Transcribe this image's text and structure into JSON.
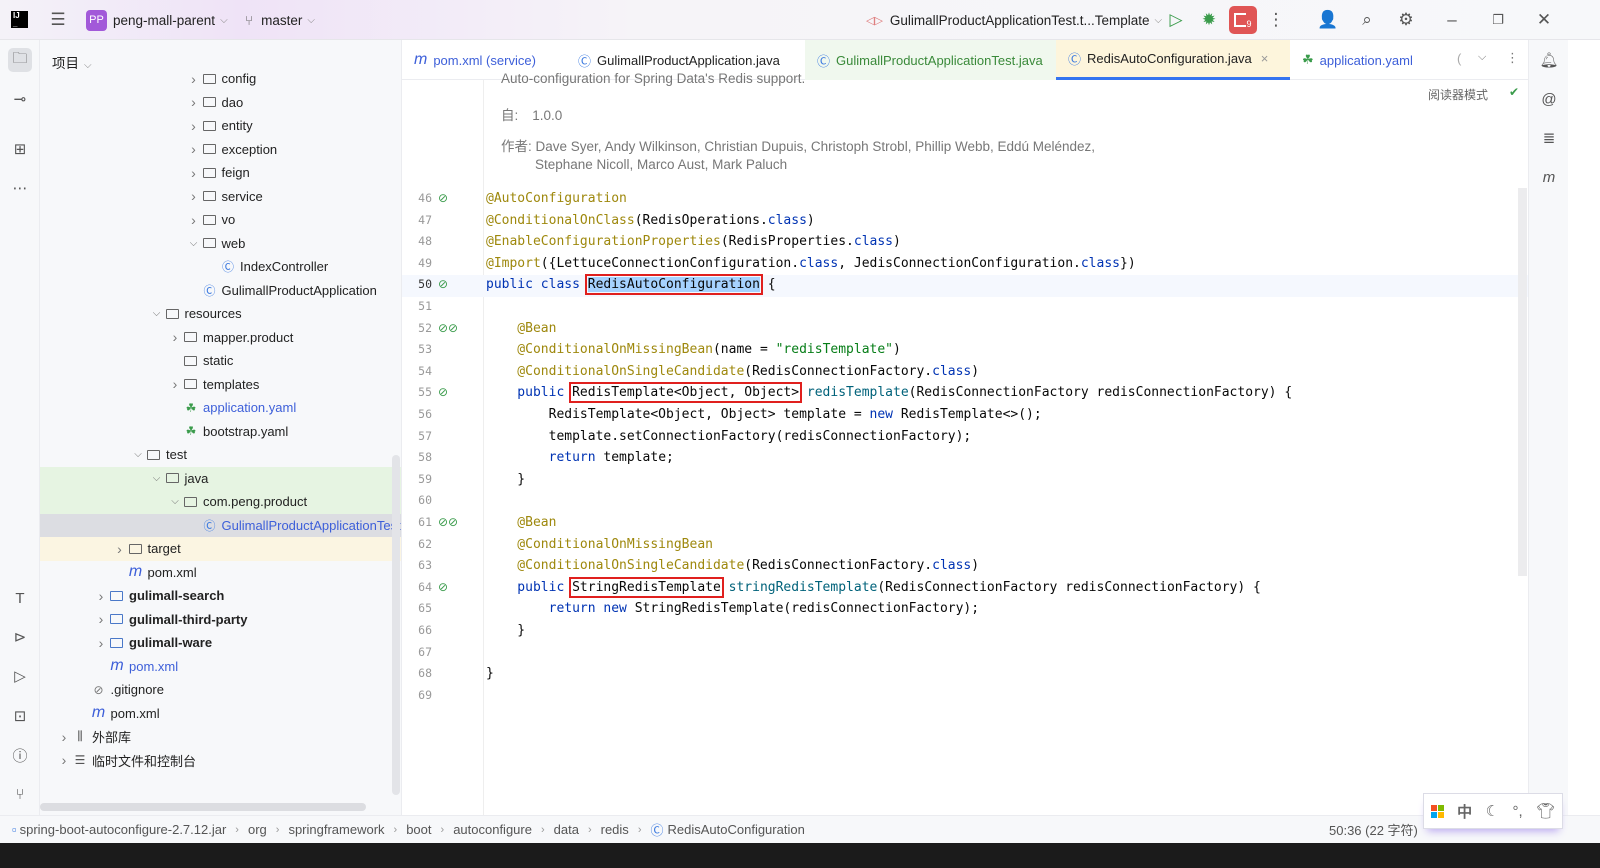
{
  "titlebar": {
    "project_initials": "PP",
    "project": "peng-mall-parent",
    "branch": "master",
    "run_config": "GulimallProductApplicationTest.t...Template",
    "badge": "9"
  },
  "panel": {
    "title": "项目"
  },
  "tree": [
    {
      "label": "config",
      "d": 7,
      "arrow": "closed",
      "icon": "folder"
    },
    {
      "label": "dao",
      "d": 7,
      "arrow": "closed",
      "icon": "folder"
    },
    {
      "label": "entity",
      "d": 7,
      "arrow": "closed",
      "icon": "folder"
    },
    {
      "label": "exception",
      "d": 7,
      "arrow": "closed",
      "icon": "folder"
    },
    {
      "label": "feign",
      "d": 7,
      "arrow": "closed",
      "icon": "folder"
    },
    {
      "label": "service",
      "d": 7,
      "arrow": "closed",
      "icon": "folder"
    },
    {
      "label": "vo",
      "d": 7,
      "arrow": "closed",
      "icon": "folder"
    },
    {
      "label": "web",
      "d": 7,
      "arrow": "open",
      "icon": "folder"
    },
    {
      "label": "IndexController",
      "d": 8,
      "icon": "class"
    },
    {
      "label": "GulimallProductApplication",
      "d": 7,
      "icon": "spring-class"
    },
    {
      "label": "resources",
      "d": 5,
      "arrow": "open",
      "icon": "folder"
    },
    {
      "label": "mapper.product",
      "d": 6,
      "arrow": "closed",
      "icon": "folder"
    },
    {
      "label": "static",
      "d": 6,
      "icon": "folder"
    },
    {
      "label": "templates",
      "d": 6,
      "arrow": "closed",
      "icon": "folder"
    },
    {
      "label": "application.yaml",
      "d": 6,
      "icon": "yaml",
      "color": "#3d5fd9"
    },
    {
      "label": "bootstrap.yaml",
      "d": 6,
      "icon": "yaml"
    },
    {
      "label": "test",
      "d": 4,
      "arrow": "open",
      "icon": "folder"
    },
    {
      "label": "java",
      "d": 5,
      "arrow": "open",
      "icon": "folder",
      "bg": "#e6f4e2"
    },
    {
      "label": "com.peng.product",
      "d": 6,
      "arrow": "open",
      "icon": "folder",
      "bg": "#e6f4e2"
    },
    {
      "label": "GulimallProductApplicationTest",
      "d": 7,
      "icon": "class",
      "bg": "#dcdde2",
      "color": "#3d5fd9"
    },
    {
      "label": "target",
      "d": 3,
      "arrow": "closed",
      "icon": "folder",
      "bg": "#fbf5e2"
    },
    {
      "label": "pom.xml",
      "d": 3,
      "icon": "maven"
    },
    {
      "label": "gulimall-search",
      "d": 2,
      "arrow": "closed",
      "icon": "module",
      "bold": true
    },
    {
      "label": "gulimall-third-party",
      "d": 2,
      "arrow": "closed",
      "icon": "module",
      "bold": true
    },
    {
      "label": "gulimall-ware",
      "d": 2,
      "arrow": "closed",
      "icon": "module",
      "bold": true
    },
    {
      "label": "pom.xml",
      "d": 2,
      "icon": "maven",
      "color": "#3d5fd9"
    },
    {
      "label": ".gitignore",
      "d": 1,
      "icon": "ignore"
    },
    {
      "label": "pom.xml",
      "d": 1,
      "icon": "maven"
    },
    {
      "label": "外部库",
      "d": 0,
      "arrow": "closed",
      "icon": "library"
    },
    {
      "label": "临时文件和控制台",
      "d": 0,
      "arrow": "closed",
      "icon": "scratch"
    }
  ],
  "tabs": [
    {
      "label": "pom.xml (service)",
      "icon": "maven",
      "color": "#3d5fd9"
    },
    {
      "label": "GulimallProductApplication.java",
      "icon": "spring-class",
      "color": "#222"
    },
    {
      "label": "GulimallProductApplicationTest.java",
      "icon": "class",
      "color": "#3a8a3a",
      "bg": "#f0f8ee"
    },
    {
      "label": "RedisAutoConfiguration.java",
      "icon": "class",
      "color": "#222",
      "bg": "#fdf5dc",
      "active": true
    },
    {
      "label": "application.yaml",
      "icon": "yaml",
      "color": "#3d5fd9"
    }
  ],
  "editor": {
    "reader_mode": "阅读器模式",
    "doc_top": "Auto-configuration for Spring Data's Redis support.",
    "since_label": "自:",
    "since_value": "1.0.0",
    "author_label": "作者:",
    "authors_1": "Dave Syer, Andy Wilkinson, Christian Dupuis, Christoph Strobl, Phillip Webb, Eddú Meléndez,",
    "authors_2": "Stephane Nicoll, Marco Aust, Mark Paluch",
    "lines": [
      {
        "n": "46",
        "g": "bean",
        "t": [
          [
            "an",
            "@AutoConfiguration"
          ]
        ]
      },
      {
        "n": "47",
        "t": [
          [
            "an",
            "@ConditionalOnClass"
          ],
          [
            "tx",
            "(RedisOperations."
          ],
          [
            "kw",
            "class"
          ],
          [
            "tx",
            ")"
          ]
        ]
      },
      {
        "n": "48",
        "t": [
          [
            "an",
            "@EnableConfigurationProperties"
          ],
          [
            "tx",
            "(RedisProperties."
          ],
          [
            "kw",
            "class"
          ],
          [
            "tx",
            ")"
          ]
        ]
      },
      {
        "n": "49",
        "t": [
          [
            "an",
            "@Import"
          ],
          [
            "tx",
            "({LettuceConnectionConfiguration."
          ],
          [
            "kw",
            "class"
          ],
          [
            "tx",
            ", JedisConnectionConfiguration."
          ],
          [
            "kw",
            "class"
          ],
          [
            "tx",
            "})"
          ]
        ]
      },
      {
        "n": "50",
        "g": "bean",
        "cur": true,
        "t": [
          [
            "kw",
            "public class "
          ],
          [
            "tx sel box",
            "RedisAutoConfiguration"
          ],
          [
            "tx",
            " {"
          ]
        ]
      },
      {
        "n": "51",
        "t": []
      },
      {
        "n": "52",
        "g": "bean2",
        "t": [
          [
            "an",
            "    @Bean"
          ]
        ]
      },
      {
        "n": "53",
        "t": [
          [
            "an",
            "    @ConditionalOnMissingBean"
          ],
          [
            "tx",
            "(name = "
          ],
          [
            "str",
            "\"redisTemplate\""
          ],
          [
            "tx",
            ")"
          ]
        ]
      },
      {
        "n": "54",
        "t": [
          [
            "an",
            "    @ConditionalOnSingleCandidate"
          ],
          [
            "tx",
            "(RedisConnectionFactory."
          ],
          [
            "kw",
            "class"
          ],
          [
            "tx",
            ")"
          ]
        ]
      },
      {
        "n": "55",
        "g": "bean",
        "t": [
          [
            "kw",
            "    public "
          ],
          [
            "tx box",
            "RedisTemplate<Object, Object>"
          ],
          [
            "fn",
            " redisTemplate"
          ],
          [
            "tx",
            "(RedisConnectionFactory redisConnectionFactory) {"
          ]
        ]
      },
      {
        "n": "56",
        "t": [
          [
            "tx",
            "        RedisTemplate<Object, Object> template = "
          ],
          [
            "kw",
            "new"
          ],
          [
            "tx",
            " RedisTemplate<>();"
          ]
        ]
      },
      {
        "n": "57",
        "t": [
          [
            "tx",
            "        template.setConnectionFactory(redisConnectionFactory);"
          ]
        ]
      },
      {
        "n": "58",
        "t": [
          [
            "kw",
            "        return"
          ],
          [
            "tx",
            " template;"
          ]
        ]
      },
      {
        "n": "59",
        "t": [
          [
            "tx",
            "    }"
          ]
        ]
      },
      {
        "n": "60",
        "t": []
      },
      {
        "n": "61",
        "g": "bean2",
        "t": [
          [
            "an",
            "    @Bean"
          ]
        ]
      },
      {
        "n": "62",
        "t": [
          [
            "an",
            "    @ConditionalOnMissingBean"
          ]
        ]
      },
      {
        "n": "63",
        "t": [
          [
            "an",
            "    @ConditionalOnSingleCandidate"
          ],
          [
            "tx",
            "(RedisConnectionFactory."
          ],
          [
            "kw",
            "class"
          ],
          [
            "tx",
            ")"
          ]
        ]
      },
      {
        "n": "64",
        "g": "bean",
        "t": [
          [
            "kw",
            "    public "
          ],
          [
            "tx box",
            "StringRedisTemplate"
          ],
          [
            "fn",
            " stringRedisTemplate"
          ],
          [
            "tx",
            "(RedisConnectionFactory redisConnectionFactory) {"
          ]
        ]
      },
      {
        "n": "65",
        "t": [
          [
            "kw",
            "        return new"
          ],
          [
            "tx",
            " StringRedisTemplate(redisConnectionFactory);"
          ]
        ]
      },
      {
        "n": "66",
        "t": [
          [
            "tx",
            "    }"
          ]
        ]
      },
      {
        "n": "67",
        "t": []
      },
      {
        "n": "68",
        "t": [
          [
            "tx",
            "}"
          ]
        ]
      },
      {
        "n": "69",
        "t": []
      }
    ]
  },
  "statusbar": {
    "breadcrumbs": [
      "spring-boot-autoconfigure-2.7.12.jar",
      "org",
      "springframework",
      "boot",
      "autoconfigure",
      "data",
      "redis",
      "RedisAutoConfiguration"
    ],
    "position": "50:36 (22 字符)"
  },
  "ime": {
    "mode": "中"
  }
}
